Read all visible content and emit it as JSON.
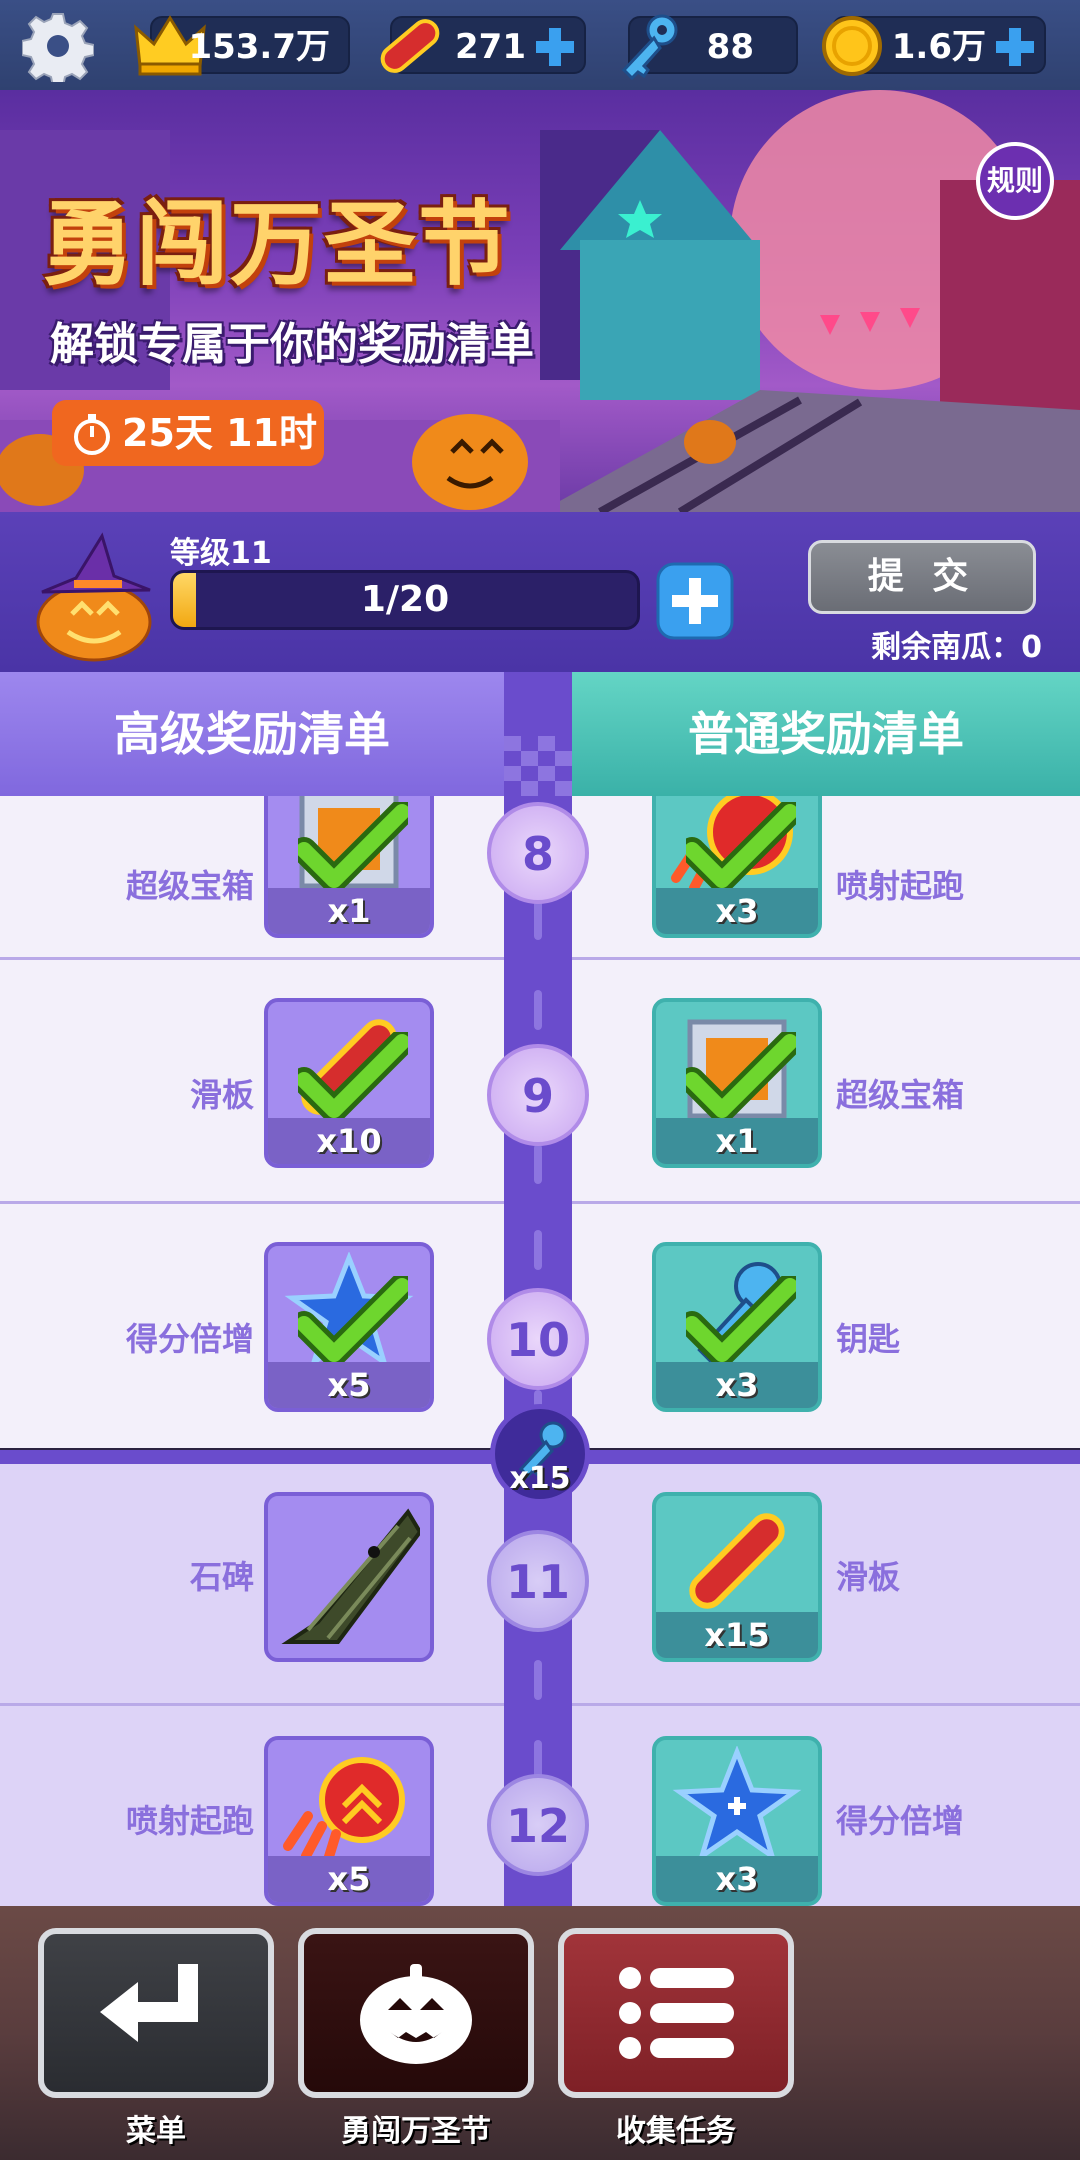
{
  "currency": {
    "crowns": "153.7万",
    "hoverboards": "271",
    "keys": "88",
    "coins": "1.6万"
  },
  "banner": {
    "title": "勇闯万圣节",
    "subtitle": "解锁专属于你的奖励清单",
    "timer": "25天 11时",
    "rules": "规则"
  },
  "level": {
    "label": "等级11",
    "progress_text": "1/20",
    "progress_fraction": 0.05,
    "submit": "提 交",
    "remaining": "剩余南瓜：0"
  },
  "tabs": {
    "premium": "高级奖励清单",
    "normal": "普通奖励清单"
  },
  "rows": [
    {
      "level": "8",
      "status": "claimed",
      "premium": {
        "name": "超级宝箱",
        "qty": "x1",
        "icon": "mystery-box-icon"
      },
      "normal": {
        "name": "喷射起跑",
        "qty": "x3",
        "icon": "headstart-icon"
      }
    },
    {
      "level": "9",
      "status": "claimed",
      "premium": {
        "name": "滑板",
        "qty": "x10",
        "icon": "hoverboard-icon"
      },
      "normal": {
        "name": "超级宝箱",
        "qty": "x1",
        "icon": "mystery-box-icon"
      }
    },
    {
      "level": "10",
      "status": "claimed",
      "premium": {
        "name": "得分倍增",
        "qty": "x5",
        "icon": "score-booster-icon"
      },
      "normal": {
        "name": "钥匙",
        "qty": "x3",
        "icon": "key-icon"
      }
    },
    {
      "level": "11",
      "status": "locked",
      "premium": {
        "name": "石碑",
        "qty": "",
        "icon": "tombstone-icon"
      },
      "normal": {
        "name": "滑板",
        "qty": "x15",
        "icon": "hoverboard-icon"
      }
    },
    {
      "level": "12",
      "status": "locked",
      "premium": {
        "name": "喷射起跑",
        "qty": "x5",
        "icon": "headstart-icon"
      },
      "normal": {
        "name": "得分倍增",
        "qty": "x3",
        "icon": "score-booster-icon"
      }
    }
  ],
  "milestone": {
    "qty": "x15",
    "icon": "key-icon"
  },
  "nav": {
    "menu": "菜单",
    "event": "勇闯万圣节",
    "tasks": "收集任务"
  },
  "colors": {
    "accent_purple": "#6a4ccc",
    "normal_teal": "#3ab1a8",
    "timer_orange": "#f0671f",
    "check_green": "#5fcf2a"
  }
}
